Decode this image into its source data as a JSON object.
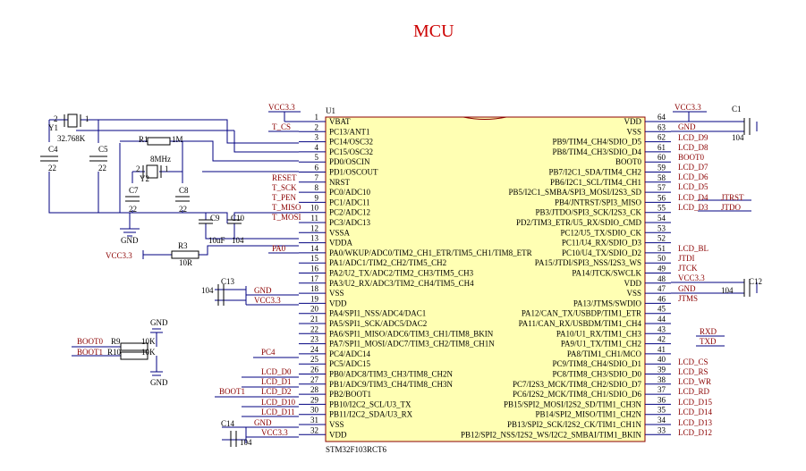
{
  "title": "MCU",
  "chip": {
    "designator": "U1",
    "part": "STM32F103RCT6"
  },
  "left_pins": [
    {
      "num": "1",
      "name": "VBAT"
    },
    {
      "num": "2",
      "name": "PC13/ANT1"
    },
    {
      "num": "3",
      "name": "PC14/OSC32"
    },
    {
      "num": "4",
      "name": "PC15/OSC32"
    },
    {
      "num": "5",
      "name": "PD0/OSCIN"
    },
    {
      "num": "6",
      "name": "PD1/OSCOUT"
    },
    {
      "num": "7",
      "name": "NRST"
    },
    {
      "num": "8",
      "name": "PC0/ADC10"
    },
    {
      "num": "9",
      "name": "PC1/ADC11"
    },
    {
      "num": "10",
      "name": "PC2/ADC12"
    },
    {
      "num": "11",
      "name": "PC3/ADC13"
    },
    {
      "num": "12",
      "name": "VSSA"
    },
    {
      "num": "13",
      "name": "VDDA"
    },
    {
      "num": "14",
      "name": "PA0/WKUP/ADC0/TIM2_CH1_ETR/TIM5_CH1/TIM8_ETR"
    },
    {
      "num": "15",
      "name": "PA1/ADC1/TIM2_CH2/TIM5_CH2"
    },
    {
      "num": "16",
      "name": "PA2/U2_TX/ADC2/TIM2_CH3/TIM5_CH3"
    },
    {
      "num": "17",
      "name": "PA3/U2_RX/ADC3/TIM2_CH4/TIM5_CH4"
    },
    {
      "num": "18",
      "name": "VSS"
    },
    {
      "num": "19",
      "name": "VDD"
    },
    {
      "num": "20",
      "name": "PA4/SPI1_NSS/ADC4/DAC1"
    },
    {
      "num": "21",
      "name": "PA5/SPI1_SCK/ADC5/DAC2"
    },
    {
      "num": "22",
      "name": "PA6/SPI1_MISO/ADC6/TIM3_CH1/TIM8_BKIN"
    },
    {
      "num": "23",
      "name": "PA7/SPI1_MOSI/ADC7/TIM3_CH2/TIM8_CH1N"
    },
    {
      "num": "24",
      "name": "PC4/ADC14"
    },
    {
      "num": "25",
      "name": "PC5/ADC15"
    },
    {
      "num": "26",
      "name": "PB0/ADC8/TIM3_CH3/TIM8_CH2N"
    },
    {
      "num": "27",
      "name": "PB1/ADC9/TIM3_CH4/TIM8_CH3N"
    },
    {
      "num": "28",
      "name": "PB2/BOOT1"
    },
    {
      "num": "29",
      "name": "PB10/I2C2_SCL/U3_TX"
    },
    {
      "num": "30",
      "name": "PB11/I2C2_SDA/U3_RX"
    },
    {
      "num": "31",
      "name": "VSS"
    },
    {
      "num": "32",
      "name": "VDD"
    }
  ],
  "right_pins": [
    {
      "num": "64",
      "name": "VDD"
    },
    {
      "num": "63",
      "name": "VSS"
    },
    {
      "num": "62",
      "name": "PB9/TIM4_CH4/SDIO_D5"
    },
    {
      "num": "61",
      "name": "PB8/TIM4_CH3/SDIO_D4"
    },
    {
      "num": "60",
      "name": "BOOT0"
    },
    {
      "num": "59",
      "name": "PB7/I2C1_SDA/TIM4_CH2"
    },
    {
      "num": "58",
      "name": "PB6/I2C1_SCL/TIM4_CH1"
    },
    {
      "num": "57",
      "name": "PB5/I2C1_SMBA/SPI3_MOSI/I2S3_SD"
    },
    {
      "num": "56",
      "name": "PB4/JNTRST/SPI3_MISO"
    },
    {
      "num": "55",
      "name": "PB3/JTDO/SPI3_SCK/I2S3_CK"
    },
    {
      "num": "54",
      "name": "PD2/TIM3_ETR/U5_RX/SDIO_CMD"
    },
    {
      "num": "53",
      "name": "PC12/U5_TX/SDIO_CK"
    },
    {
      "num": "52",
      "name": "PC11/U4_RX/SDIO_D3"
    },
    {
      "num": "51",
      "name": "PC10/U4_TX/SDIO_D2"
    },
    {
      "num": "50",
      "name": "PA15/JTDI/SPI3_NSS/I2S3_WS"
    },
    {
      "num": "49",
      "name": "PA14/JTCK/SWCLK"
    },
    {
      "num": "48",
      "name": "VDD"
    },
    {
      "num": "47",
      "name": "VSS"
    },
    {
      "num": "46",
      "name": "PA13/JTMS/SWDIO"
    },
    {
      "num": "45",
      "name": "PA12/CAN_TX/USBDP/TIM1_ETR"
    },
    {
      "num": "44",
      "name": "PA11/CAN_RX/USBDM/TIM1_CH4"
    },
    {
      "num": "43",
      "name": "PA10/U1_RX/TIM1_CH3"
    },
    {
      "num": "42",
      "name": "PA9/U1_TX/TIM1_CH2"
    },
    {
      "num": "41",
      "name": "PA8/TIM1_CH1/MCO"
    },
    {
      "num": "40",
      "name": "PC9/TIM8_CH4/SDIO_D1"
    },
    {
      "num": "39",
      "name": "PC8/TIM8_CH3/SDIO_D0"
    },
    {
      "num": "38",
      "name": "PC7/I2S3_MCK/TIM8_CH2/SDIO_D7"
    },
    {
      "num": "37",
      "name": "PC6/I2S2_MCK/TIM8_CH1/SDIO_D6"
    },
    {
      "num": "36",
      "name": "PB15/SPI2_MOSI/I2S2_SD/TIM1_CH3N"
    },
    {
      "num": "35",
      "name": "PB14/SPI2_MISO/TIM1_CH2N"
    },
    {
      "num": "34",
      "name": "PB13/SPI2_SCK/I2S2_CK/TIM1_CH1N"
    },
    {
      "num": "33",
      "name": "PB12/SPI2_NSS/I2S2_WS/I2C2_SMBAI/TIM1_BKIN"
    }
  ],
  "left_nets": {
    "VCC3.3 (1)": "VCC3.3",
    "2": "T_CS",
    "7": "RESET",
    "8": "T_SCK",
    "9": "T_PEN",
    "10": "T_MISO",
    "11": "T_MOSI",
    "14": "PA0",
    "18": "GND",
    "19": "VCC3.3",
    "24": "PC4",
    "26": "LCD_D0",
    "27": "LCD_D1",
    "28a": "BOOT1",
    "28b": "LCD_D2",
    "29": "LCD_D10",
    "30": "LCD_D11",
    "31": "GND",
    "32": "VCC3.3"
  },
  "right_nets": {
    "top": "VCC3.3",
    "63": "GND",
    "62": "LCD_D9",
    "61": "LCD_D8",
    "60": "BOOT0",
    "59": "LCD_D7",
    "58": "LCD_D6",
    "57": "LCD_D5",
    "56": "LCD_D4",
    "56b": "JTRST",
    "55": "LCD_D3",
    "55b": "JTDO",
    "51": "LCD_BL",
    "50": "JTDI",
    "49": "JTCK",
    "48": "VCC3.3",
    "47": "GND",
    "46": "JTMS",
    "43": "RXD",
    "42": "TXD",
    "40": "LCD_CS",
    "39": "LCD_RS",
    "38": "LCD_WR",
    "37": "LCD_RD",
    "36": "LCD_D15",
    "35": "LCD_D14",
    "34": "LCD_D13",
    "33": "LCD_D12"
  },
  "components": {
    "Y1": "Y1",
    "Y1_val": "32.768K",
    "C4": "C4",
    "C4_val": "22",
    "C5": "C5",
    "C5_val": "22",
    "R1": "R1",
    "R1_val": "1M",
    "Y2": "Y2",
    "Y2_val": "8MHz",
    "C7": "C7",
    "C7_val": "22",
    "C8": "C8",
    "C8_val": "22",
    "C9": "C9",
    "C9_val": "10uF",
    "C10": "C10",
    "C10_val": "104",
    "R3": "R3",
    "R3_val": "10R",
    "r3_net": "VCC3.3",
    "gnd_a": "GND",
    "C13": "C13",
    "C13_val": "104",
    "C14": "C14",
    "C14_val": "104",
    "C1": "C1",
    "C1_val": "104",
    "C12": "C12",
    "C12_val": "104",
    "boot0_lbl": "BOOT0",
    "boot0_r": "R9",
    "boot0_val": "10K",
    "boot1_lbl": "BOOT1",
    "boot1_r": "R10",
    "boot1_val": "10K",
    "gnd_b": "GND",
    "gnd_c": "GND",
    "y1_p1": "1",
    "y1_p2": "2",
    "y2_p1": "1",
    "y2_p2": "2"
  },
  "colors": {
    "title": "#cc0000",
    "net": "#8b0000",
    "chip_fill": "#ffffb3",
    "wire": "#000080"
  }
}
